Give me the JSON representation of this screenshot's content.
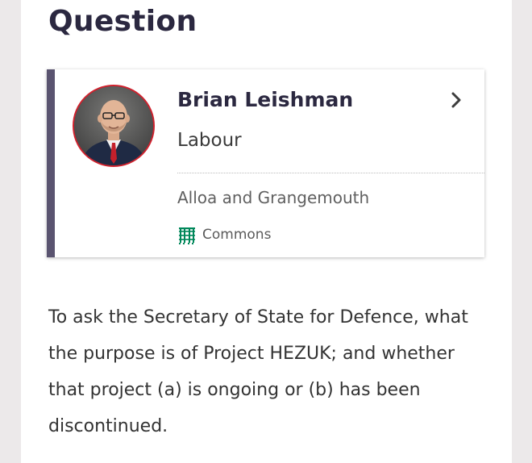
{
  "page": {
    "heading": "Question"
  },
  "member": {
    "name": "Brian Leishman",
    "party": "Labour",
    "constituency": "Alloa and Grangemouth",
    "house": "Commons",
    "party_color": "#d0212d",
    "accent_color": "#5a5470",
    "house_color": "#00875a"
  },
  "question": {
    "text": "To ask the Secretary of State for Defence, what the purpose is of Project HEZUK; and whether that project (a) is ongoing or (b) has been discontinued."
  },
  "icons": {
    "chevron": "chevron-right-icon",
    "house": "portcullis-icon"
  }
}
